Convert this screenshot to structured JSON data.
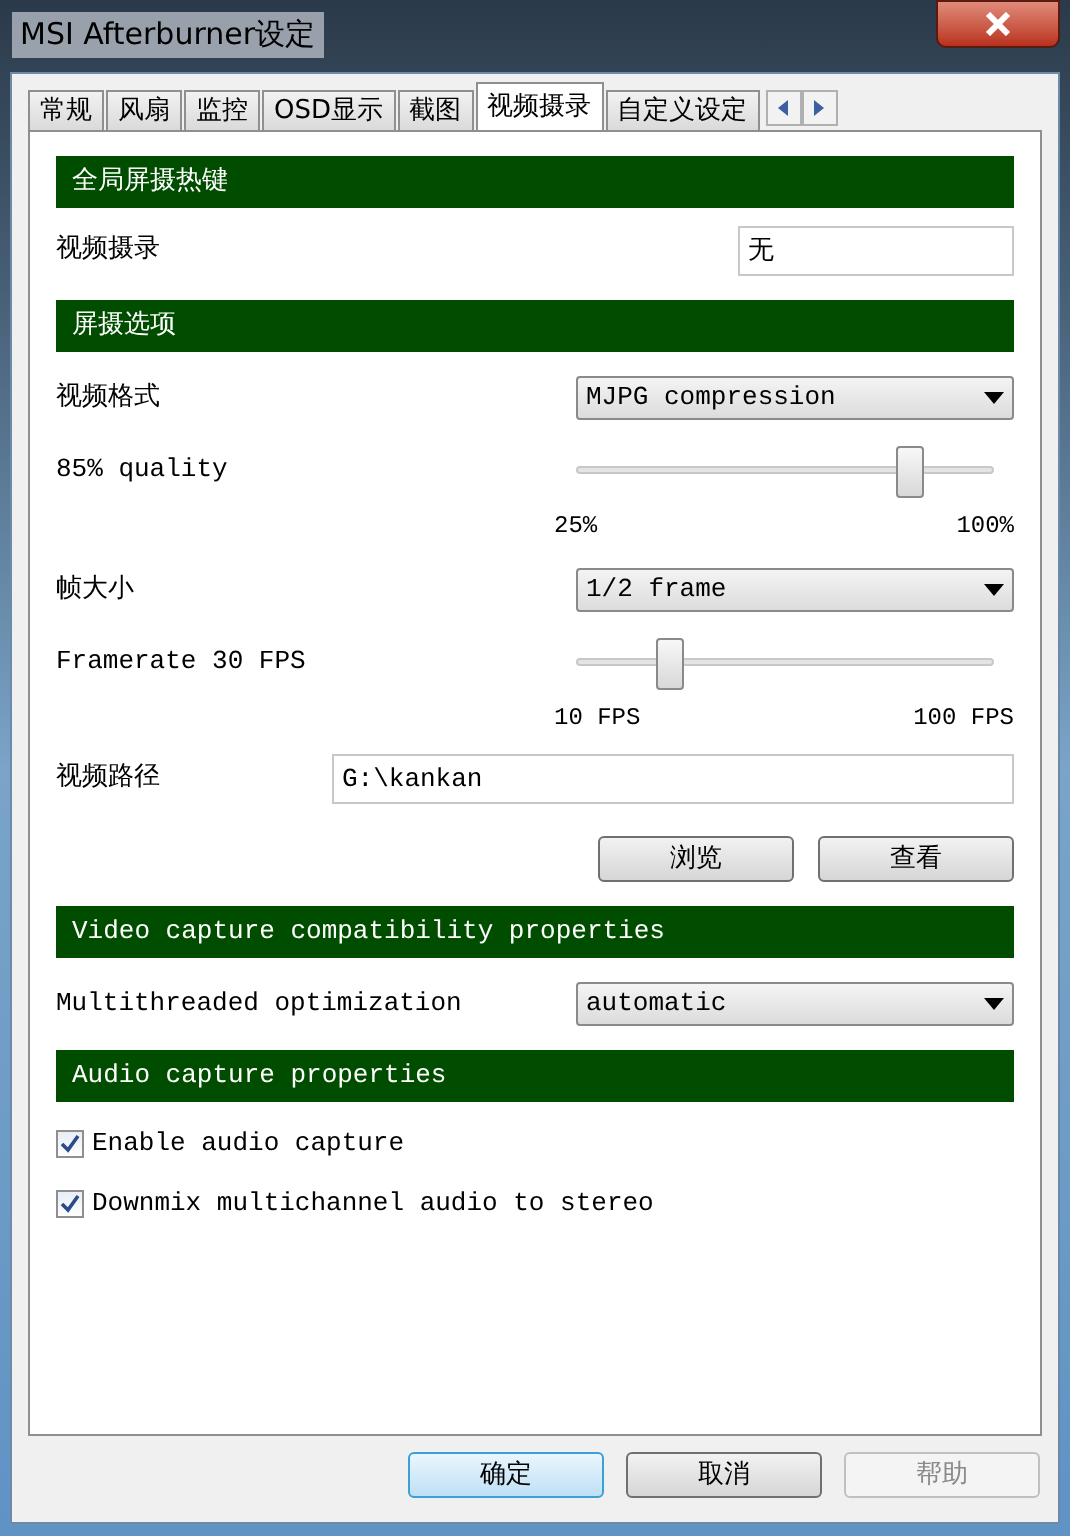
{
  "window": {
    "title": "MSI Afterburner设定"
  },
  "tabs": [
    {
      "label": "常规",
      "selected": false
    },
    {
      "label": "风扇",
      "selected": false
    },
    {
      "label": "监控",
      "selected": false
    },
    {
      "label": "OSD显示",
      "selected": false
    },
    {
      "label": "截图",
      "selected": false
    },
    {
      "label": "视频摄录",
      "selected": true
    },
    {
      "label": "自定义设定",
      "selected": false
    }
  ],
  "sections": [
    {
      "kind": "header",
      "title": "全局屏摄热键"
    },
    {
      "kind": "hotkey",
      "label": "视频摄录",
      "value": "无"
    },
    {
      "kind": "header",
      "title": "屏摄选项"
    },
    {
      "kind": "dropdown",
      "label": "视频格式",
      "value": "MJPG compression"
    },
    {
      "kind": "slider",
      "label": "85% quality",
      "level": 0.8,
      "min_label": "25%",
      "max_label": "100%"
    },
    {
      "kind": "dropdown",
      "label": "帧大小",
      "value": "1/2 frame"
    },
    {
      "kind": "slider",
      "label": "Framerate 30 FPS",
      "level": 0.22,
      "min_label": "10 FPS",
      "max_label": "100 FPS"
    },
    {
      "kind": "field",
      "label": "视频路径",
      "value": "G:\\kankan"
    },
    {
      "kind": "buttons",
      "buttons": [
        "浏览",
        "查看"
      ]
    },
    {
      "kind": "header",
      "title": "Video capture compatibility properties"
    },
    {
      "kind": "dropdown",
      "label": "Multithreaded optimization",
      "value": "automatic"
    },
    {
      "kind": "header",
      "title": "Audio capture properties"
    },
    {
      "kind": "checkbox",
      "label": "Enable audio capture",
      "checked": true
    },
    {
      "kind": "checkbox",
      "label": "Downmix multichannel audio to stereo",
      "checked": true
    }
  ],
  "footer_buttons": [
    {
      "label": "确定",
      "disabled": false,
      "default": true
    },
    {
      "label": "取消",
      "disabled": false,
      "default": false
    },
    {
      "label": "帮助",
      "disabled": true,
      "default": false
    }
  ]
}
